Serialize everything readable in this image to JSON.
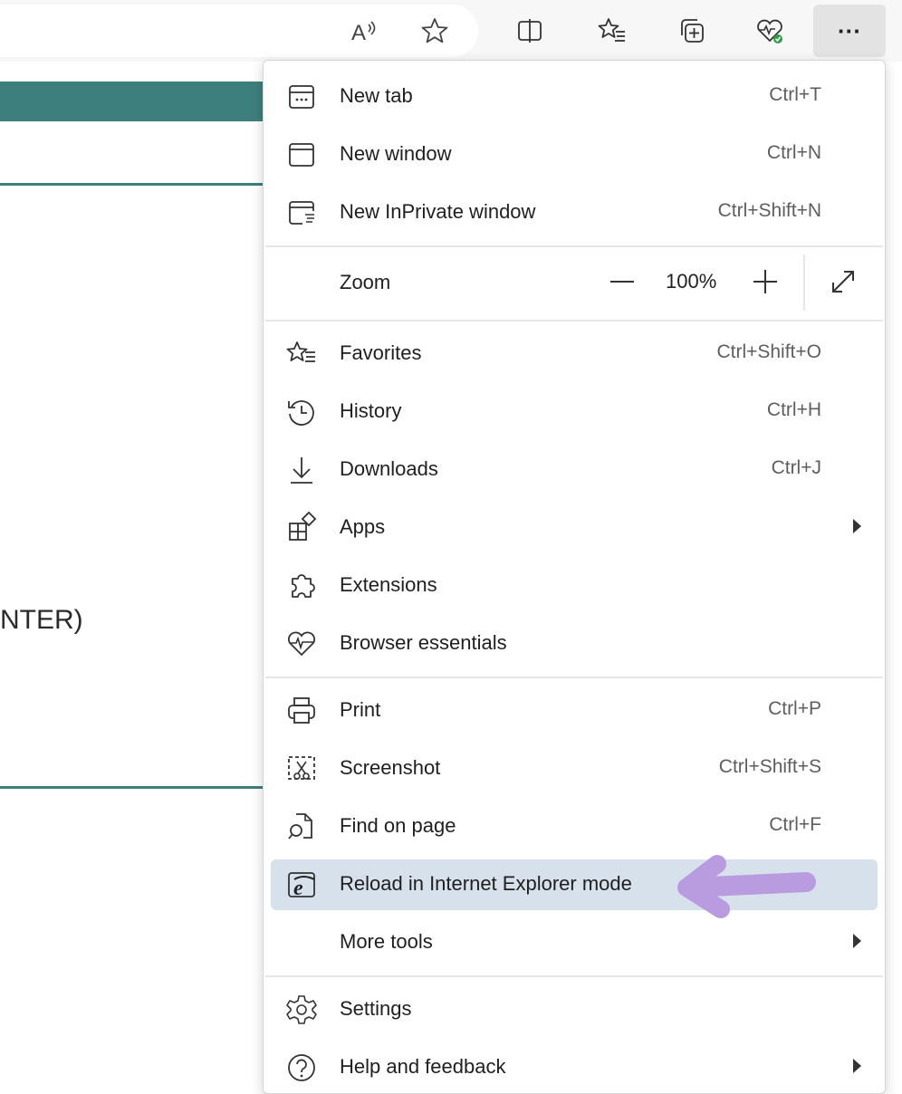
{
  "page": {
    "fragment_text": "NTER)"
  },
  "toolbar": {
    "read_aloud_icon": "read-aloud-icon",
    "favorite_icon": "star-icon",
    "split_icon": "split-screen-icon",
    "favorites_icon": "favorites-icon",
    "collections_icon": "collections-icon",
    "essentials_icon": "browser-essentials-icon",
    "more_label": "···"
  },
  "menu": {
    "new_tab": {
      "label": "New tab",
      "shortcut": "Ctrl+T"
    },
    "new_window": {
      "label": "New window",
      "shortcut": "Ctrl+N"
    },
    "new_inprivate": {
      "label": "New InPrivate window",
      "shortcut": "Ctrl+Shift+N"
    },
    "zoom": {
      "label": "Zoom",
      "value": "100%"
    },
    "favorites": {
      "label": "Favorites",
      "shortcut": "Ctrl+Shift+O"
    },
    "history": {
      "label": "History",
      "shortcut": "Ctrl+H"
    },
    "downloads": {
      "label": "Downloads",
      "shortcut": "Ctrl+J"
    },
    "apps": {
      "label": "Apps"
    },
    "extensions": {
      "label": "Extensions"
    },
    "browser_essentials": {
      "label": "Browser essentials"
    },
    "print": {
      "label": "Print",
      "shortcut": "Ctrl+P"
    },
    "screenshot": {
      "label": "Screenshot",
      "shortcut": "Ctrl+Shift+S"
    },
    "find_on_page": {
      "label": "Find on page",
      "shortcut": "Ctrl+F"
    },
    "reload_ie": {
      "label": "Reload in Internet Explorer mode"
    },
    "more_tools": {
      "label": "More tools"
    },
    "settings": {
      "label": "Settings"
    },
    "help": {
      "label": "Help and feedback"
    }
  },
  "colors": {
    "teal": "#3d7f7c",
    "highlight": "#d7e1ec",
    "annotation": "#b99be0"
  }
}
